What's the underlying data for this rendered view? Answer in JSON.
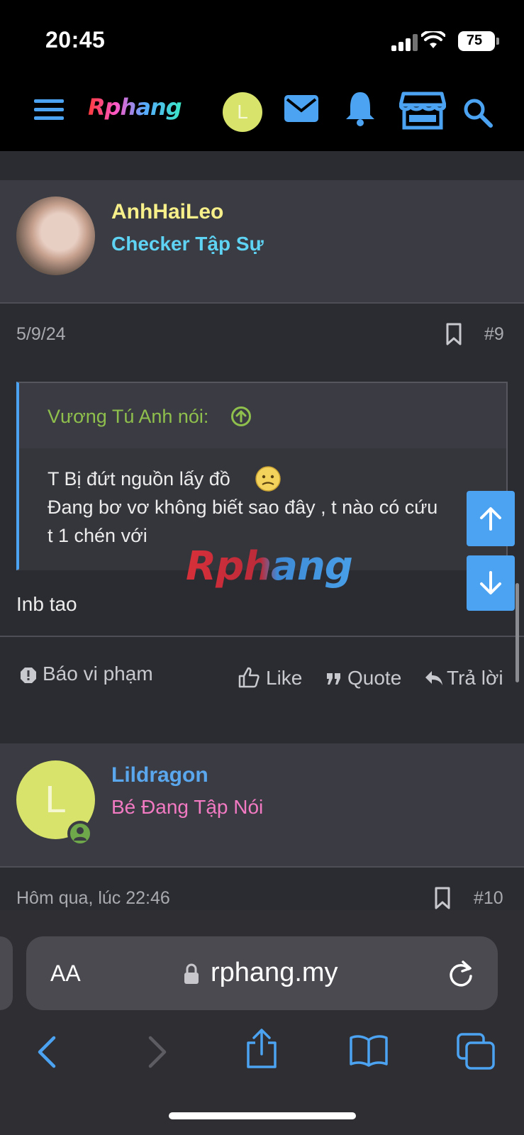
{
  "status_bar": {
    "time": "20:45",
    "battery": "75"
  },
  "header": {
    "logo": "Rphang",
    "avatar_letter": "L"
  },
  "posts": [
    {
      "username": "AnhHaiLeo",
      "user_title": "Checker Tập Sự",
      "date": "5/9/24",
      "number": "#9",
      "quote": {
        "author": "Vương Tú Anh nói:",
        "lines": [
          "T Bị đứt nguồn lấy đồ",
          "Đang bơ vơ không biết sao đây , t nào có cứu",
          "t 1 chén với"
        ]
      },
      "body": "Inb tao",
      "actions": {
        "report": "Báo vi phạm",
        "like": "Like",
        "quote": "Quote",
        "reply": "Trả lời"
      }
    },
    {
      "username": "Lildragon",
      "user_title": "Bé Đang Tập Nói",
      "avatar_letter": "L",
      "date": "Hôm qua, lúc 22:46",
      "number": "#10"
    }
  ],
  "watermark": "Rphang",
  "browser": {
    "text_size": "AA",
    "url": "rphang.my"
  },
  "colors": {
    "accent_blue": "#4ca3f2",
    "username_yellow": "#f7ef8a",
    "title_cyan": "#5fd3f3",
    "username_blue": "#5aa7ee",
    "title_pink": "#f27ac3",
    "quote_green": "#8fbf4c"
  }
}
